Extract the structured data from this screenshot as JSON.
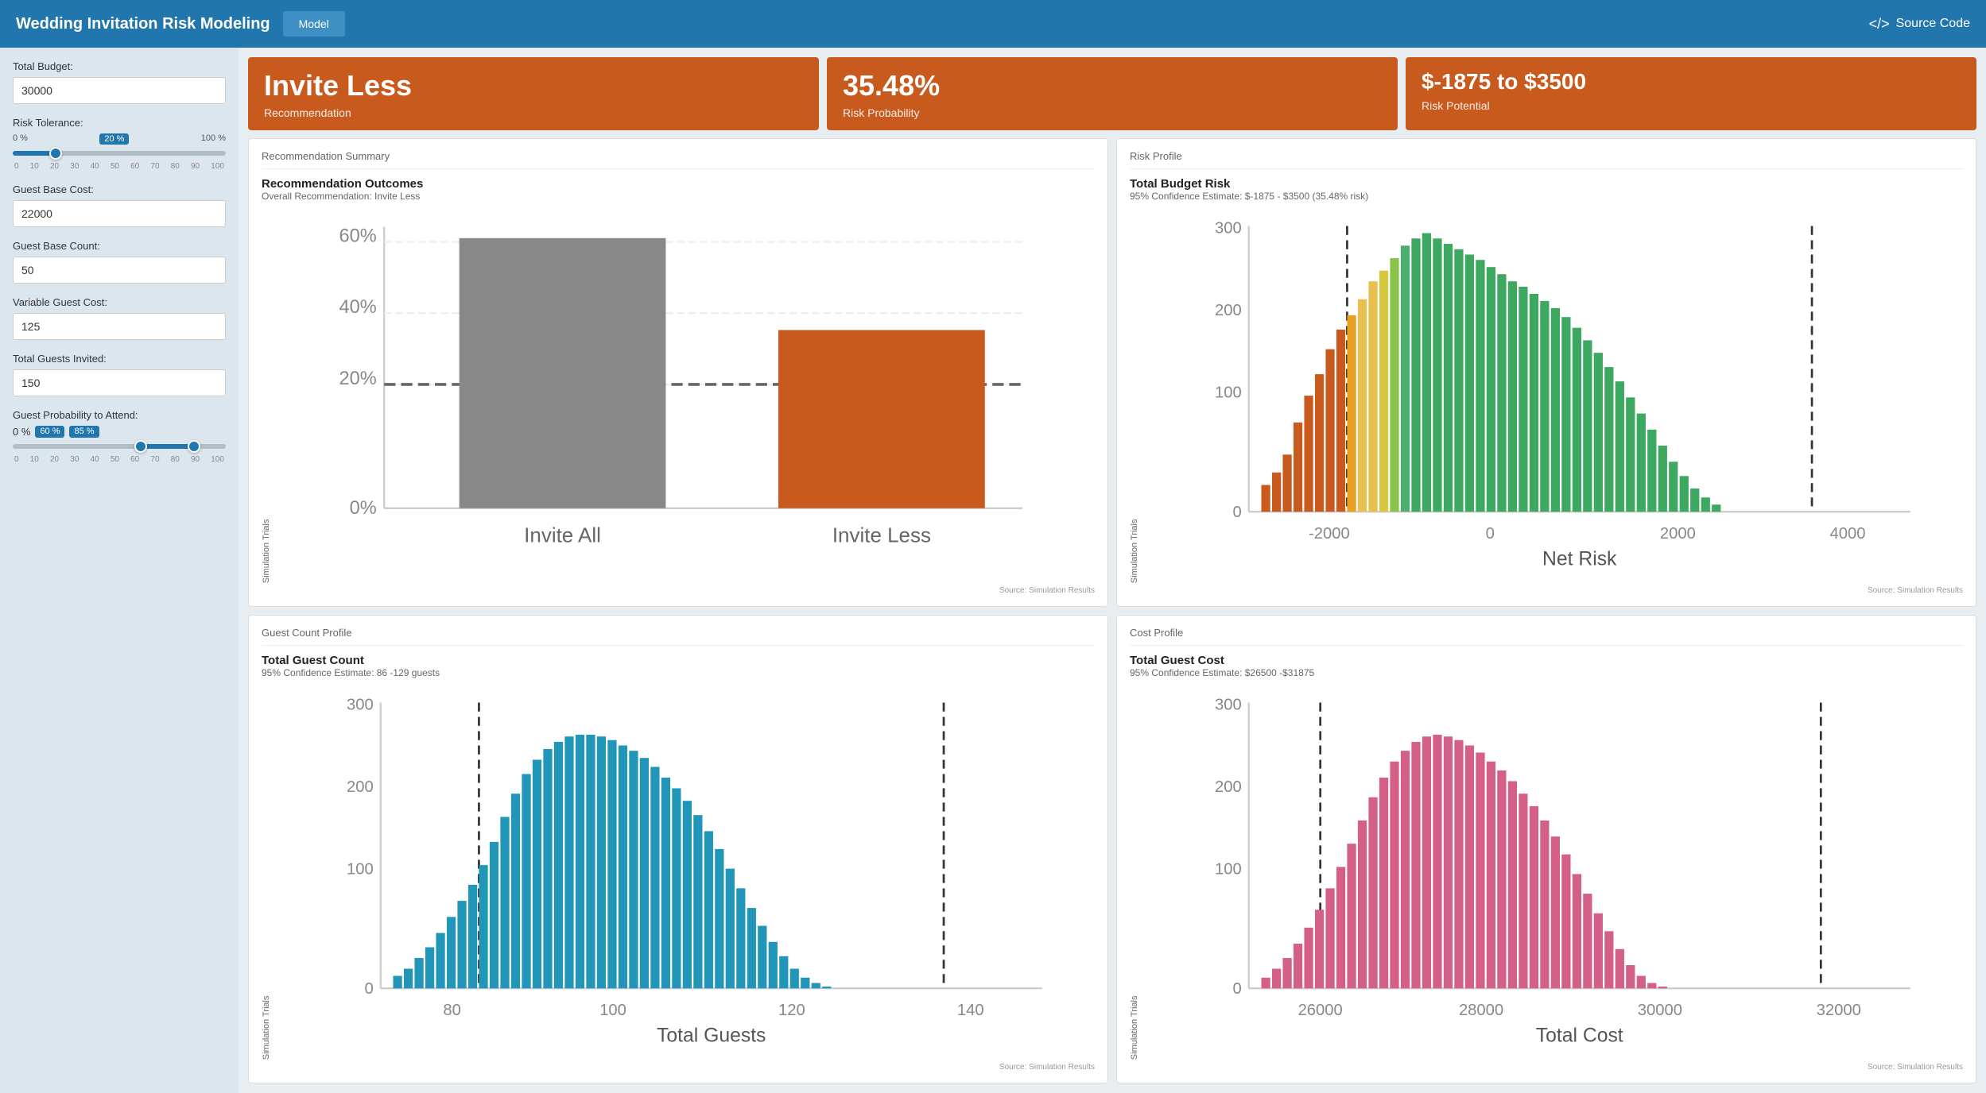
{
  "header": {
    "title": "Wedding Invitation Risk Modeling",
    "tab_label": "Model",
    "source_code_label": "Source Code"
  },
  "sidebar": {
    "fields": [
      {
        "id": "total-budget",
        "label": "Total Budget:",
        "value": "30000",
        "type": "input"
      },
      {
        "id": "risk-tolerance",
        "label": "Risk Tolerance:",
        "type": "slider",
        "min_label": "0 %",
        "value_label": "20 %",
        "max_label": "100 %",
        "value_pct": 20,
        "ticks": [
          "0",
          "10",
          "20",
          "30",
          "40",
          "50",
          "60",
          "70",
          "80",
          "90",
          "100"
        ]
      },
      {
        "id": "guest-base-cost",
        "label": "Guest Base Cost:",
        "value": "22000",
        "type": "input"
      },
      {
        "id": "guest-base-count",
        "label": "Guest Base Count:",
        "value": "50",
        "type": "input"
      },
      {
        "id": "variable-guest-cost",
        "label": "Variable Guest Cost:",
        "value": "125",
        "type": "input"
      },
      {
        "id": "total-guests-invited",
        "label": "Total Guests Invited:",
        "value": "150",
        "type": "input"
      },
      {
        "id": "guest-prob-attend",
        "label": "Guest Probability to Attend:",
        "type": "dual-slider",
        "min_label": "0 %",
        "value1_label": "60 %",
        "value2_label": "85 %",
        "val1_pct": 60,
        "val2_pct": 85,
        "ticks": [
          "0",
          "10",
          "20",
          "30",
          "40",
          "50",
          "60",
          "70",
          "80",
          "90",
          "100"
        ]
      }
    ]
  },
  "kpi": [
    {
      "id": "recommendation",
      "value": "Invite Less",
      "label": "Recommendation",
      "color": "#c85a1e"
    },
    {
      "id": "risk-probability",
      "value": "35.48%",
      "label": "Risk Probability",
      "color": "#c85a1e"
    },
    {
      "id": "risk-potential",
      "value": "$-1875 to $3500",
      "label": "Risk Potential",
      "color": "#c85a1e"
    }
  ],
  "panels": {
    "recommendation_summary": {
      "title": "Recommendation Summary",
      "chart_title": "Recommendation Outcomes",
      "chart_subtitle": "Overall Recommendation: Invite Less",
      "y_axis_label": "Simulation Trials",
      "x_labels": [
        "Invite All",
        "Invite Less"
      ],
      "bars": [
        {
          "label": "Invite All",
          "height_pct": 62,
          "color": "#888"
        },
        {
          "label": "Invite Less",
          "height_pct": 38,
          "color": "#c85a1e"
        }
      ],
      "y_ticks": [
        "60%",
        "40%",
        "20%",
        "0%"
      ],
      "dashed_line_pct": 20,
      "source": "Source: Simulation Results"
    },
    "risk_profile": {
      "title": "Risk Profile",
      "chart_title": "Total Budget Risk",
      "chart_subtitle": "95% Confidence Estimate: $-1875 - $3500 (35.48% risk)",
      "y_axis_label": "Simulation Trials",
      "x_axis_label": "Net Risk",
      "x_labels": [
        "-2000",
        "0",
        "2000",
        "4000"
      ],
      "y_max": 300,
      "source": "Source: Simulation Results"
    },
    "guest_count_profile": {
      "title": "Guest Count Profile",
      "chart_title": "Total Guest Count",
      "chart_subtitle": "95% Confidence Estimate: 86 -129 guests",
      "y_axis_label": "Simulation Trials",
      "x_axis_label": "Total Guests",
      "x_labels": [
        "80",
        "100",
        "120",
        "140"
      ],
      "y_max": 300,
      "source": "Source: Simulation Results"
    },
    "cost_profile": {
      "title": "Cost Profile",
      "chart_title": "Total Guest Cost",
      "chart_subtitle": "95% Confidence Estimate: $26500 -$31875",
      "y_axis_label": "Simulation Trials",
      "x_axis_label": "Total Cost",
      "x_labels": [
        "26000",
        "28000",
        "30000",
        "32000"
      ],
      "y_max": 300,
      "source": "Source: Simulation Results"
    }
  }
}
